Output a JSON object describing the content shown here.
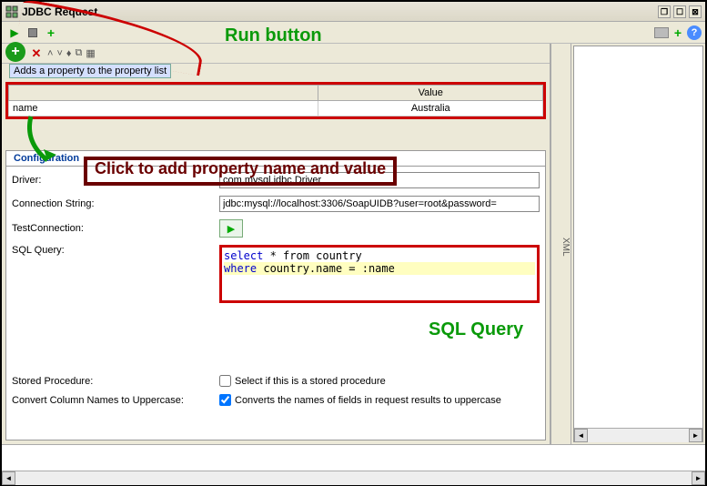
{
  "title": "JDBC Request",
  "annotations": {
    "run": "Run button",
    "click_add": "Click to add property name and value",
    "sql_query": "SQL Query"
  },
  "tooltip": "Adds a property to the property list",
  "property_table": {
    "headers": {
      "name": "",
      "value": "Value"
    },
    "rows": [
      {
        "name": "name",
        "value": "Australia"
      }
    ]
  },
  "tabs": {
    "config": "Configuration",
    "xml": "XML"
  },
  "form": {
    "driver_label": "Driver:",
    "driver_value": "com.mysql.jdbc.Driver",
    "conn_label": "Connection String:",
    "conn_value": "jdbc:mysql://localhost:3306/SoapUIDB?user=root&password=",
    "test_label": "TestConnection:",
    "sql_label": "SQL Query:",
    "sql_line1_kw": "select",
    "sql_line1_rest": " * from country",
    "sql_line2_kw": "where",
    "sql_line2_rest": " country.name = :name",
    "stored_label": "Stored Procedure:",
    "stored_check": "Select if this is a stored procedure",
    "convert_label": "Convert Column Names to Uppercase:",
    "convert_check": "Converts the names of fields in request results to uppercase"
  }
}
